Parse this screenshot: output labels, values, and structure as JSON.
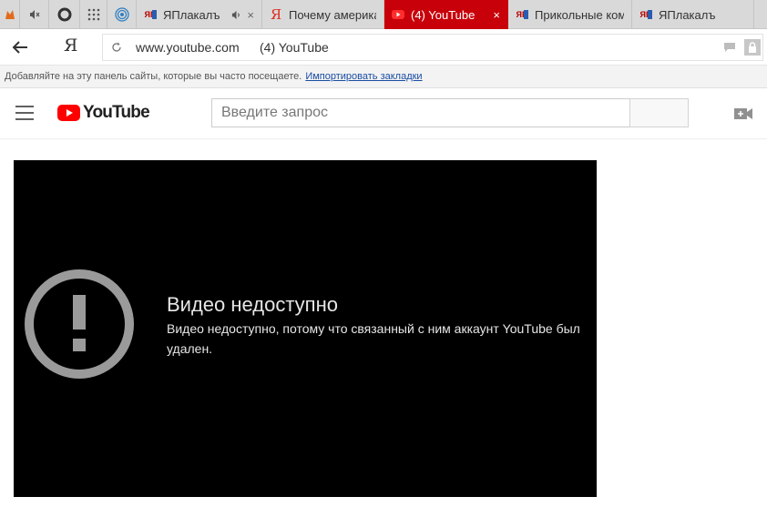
{
  "browser": {
    "tabs": [
      {
        "title": "ЯПлакалъ",
        "icon": "yaplakal-icon",
        "muted_icon": "speaker-icon"
      },
      {
        "title": "Почему америка",
        "icon": "yandex-icon"
      },
      {
        "title": "(4) YouTube",
        "icon": "youtube-icon",
        "active": true
      },
      {
        "title": "Прикольные ком",
        "icon": "yaplakal-icon"
      },
      {
        "title": "ЯПлакалъ",
        "icon": "yaplakal-icon"
      }
    ],
    "tab_close_glyph": "×",
    "yaplakal_letters": "ЯП",
    "address": {
      "yandex_logo": "Я",
      "url": "www.youtube.com",
      "page_title": "(4) YouTube"
    },
    "bookmarks_hint": {
      "text": "Добавляйте на эту панель сайты, которые вы часто посещаете.",
      "link": "Импортировать закладки"
    },
    "colors": {
      "active_tab": "#c8000a",
      "tabstrip": "#d9d9d9"
    }
  },
  "youtube": {
    "logo_text": "YouTube",
    "search_placeholder": "Введите запрос",
    "colors": {
      "brand_red": "#ff0000"
    }
  },
  "player": {
    "error_title": "Видео недоступно",
    "error_message": "Видео недоступно, потому что связанный с ним аккаунт YouTube был удален.",
    "error_icon": "exclamation-circle-icon"
  }
}
